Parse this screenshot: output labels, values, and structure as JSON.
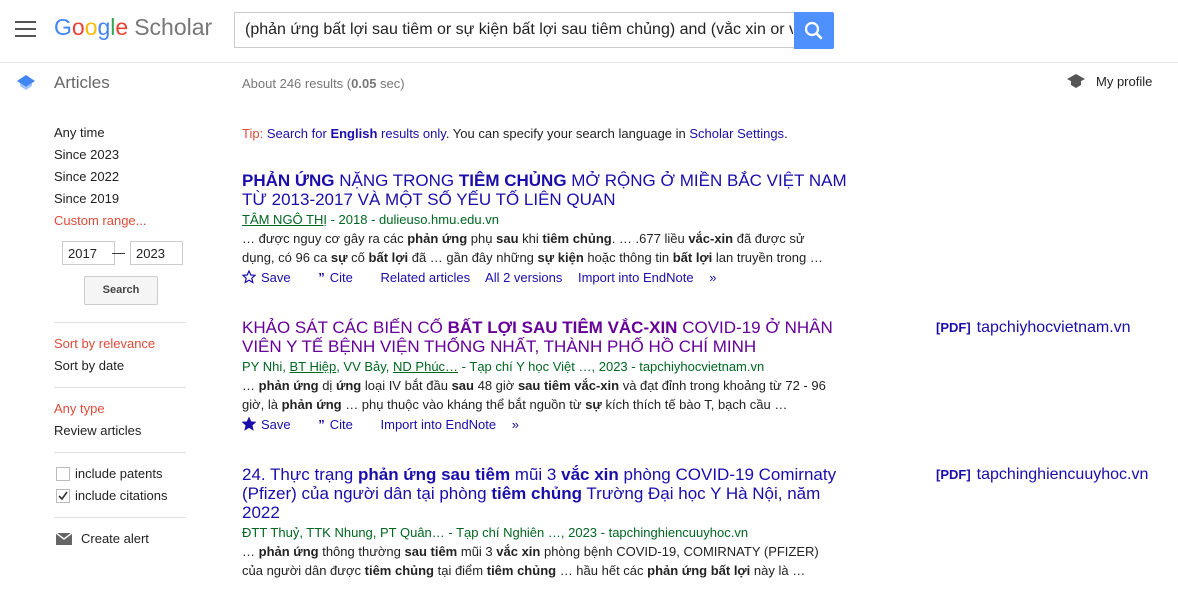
{
  "header": {
    "logo_google": [
      "G",
      "o",
      "o",
      "g",
      "l",
      "e"
    ],
    "logo_scholar": "Scholar",
    "search_query": "(phản ứng bất lợi sau tiêm or sự kiện bất lợi sau tiêm chủng) and (vắc xin or vaccine)"
  },
  "subheader": {
    "section_label": "Articles",
    "result_prefix": "About 246 results (",
    "result_time": "0.05",
    "result_suffix": " sec)",
    "my_profile": "My profile"
  },
  "sidebar": {
    "time_filters": [
      "Any time",
      "Since 2023",
      "Since 2022",
      "Since 2019",
      "Custom range..."
    ],
    "year_from": "2017",
    "year_to": "2023",
    "year_dash": "—",
    "search_label": "Search",
    "sort_filters": [
      "Sort by relevance",
      "Sort by date"
    ],
    "type_filters": [
      "Any type",
      "Review articles"
    ],
    "include_patents": "include patents",
    "include_citations": "include citations",
    "create_alert": "Create alert"
  },
  "tip": {
    "tip_label": "Tip:",
    "search_for": "Search for",
    "english": "English",
    "results_only": "results only",
    "middle": ". You can specify your search language in",
    "settings": "Scholar Settings",
    "end": "."
  },
  "results": [
    {
      "title_segments": [
        {
          "t": "PHẢN ỨNG",
          "b": true
        },
        {
          "t": " NẶNG TRONG ",
          "b": false
        },
        {
          "t": "TIÊM CHỦNG",
          "b": true
        },
        {
          "t": " MỞ RỘNG Ở MIỀN BẮC VIỆT NAM TỪ 2013-2017 VÀ MỘT SỐ YẾU TỐ LIÊN QUAN",
          "b": false
        }
      ],
      "author_link": "TÂM NGÔ THỊ",
      "author_rest": " - 2018 - dulieuso.hmu.edu.vn",
      "snippet_segments": [
        {
          "t": "… được nguy cơ gây ra các ",
          "b": false
        },
        {
          "t": "phản ứng",
          "b": true
        },
        {
          "t": " phụ ",
          "b": false
        },
        {
          "t": "sau",
          "b": true
        },
        {
          "t": " khi ",
          "b": false
        },
        {
          "t": "tiêm chủng",
          "b": true
        },
        {
          "t": ". … .677 liều ",
          "b": false
        },
        {
          "t": "vắc-xin",
          "b": true
        },
        {
          "t": " đã được sử dụng, có 96 ca ",
          "b": false
        },
        {
          "t": "sự",
          "b": true
        },
        {
          "t": " cố ",
          "b": false
        },
        {
          "t": "bất lợi",
          "b": true
        },
        {
          "t": " đã … gần đây những ",
          "b": false
        },
        {
          "t": "sự kiện",
          "b": true
        },
        {
          "t": " hoặc thông tin ",
          "b": false
        },
        {
          "t": "bất lợi",
          "b": true
        },
        {
          "t": " lan truyền trong …",
          "b": false
        }
      ],
      "actions": [
        "Save",
        "Cite",
        "Related articles",
        "All 2 versions",
        "Import into EndNote"
      ]
    },
    {
      "title_segments": [
        {
          "t": "KHẢO SÁT CÁC BIẾN CỐ ",
          "b": false
        },
        {
          "t": "BẤT LỢI SAU TIÊM VẮC-XIN",
          "b": true
        },
        {
          "t": " COVID-19 Ở NHÂN VIÊN Y TẾ BỆNH VIỆN THỐNG NHẤT, THÀNH PHỐ HỒ CHÍ MINH",
          "b": false
        }
      ],
      "authors_a": "PY Nhi, ",
      "authors_b": "BT Hiệp",
      "authors_c": ", VV Bảy, ",
      "authors_d": "ND Phúc…",
      "authors_e": " - Tạp chí Y học Việt …, 2023 - tapchiyhocvietnam.vn",
      "snippet_segments": [
        {
          "t": "… ",
          "b": false
        },
        {
          "t": "phản ứng",
          "b": true
        },
        {
          "t": " dị ",
          "b": false
        },
        {
          "t": "ứng",
          "b": true
        },
        {
          "t": " loại IV bắt đầu ",
          "b": false
        },
        {
          "t": "sau",
          "b": true
        },
        {
          "t": " 48 giờ ",
          "b": false
        },
        {
          "t": "sau tiêm vắc-xin",
          "b": true
        },
        {
          "t": " và đạt đỉnh trong khoảng từ 72 - 96 giờ, là ",
          "b": false
        },
        {
          "t": "phản ứng",
          "b": true
        },
        {
          "t": " … phụ thuộc vào kháng thể bắt nguồn từ ",
          "b": false
        },
        {
          "t": "sự",
          "b": true
        },
        {
          "t": " kích thích tế bào T, bạch cầu …",
          "b": false
        }
      ],
      "actions": [
        "Save",
        "Cite",
        "Import into EndNote"
      ],
      "pdf_tag": "[PDF]",
      "pdf_source": "tapchiyhocvietnam.vn"
    },
    {
      "title_segments": [
        {
          "t": "24. Thực trạng ",
          "b": false
        },
        {
          "t": "phản ứng sau tiêm",
          "b": true
        },
        {
          "t": " mũi 3 ",
          "b": false
        },
        {
          "t": "vắc xin",
          "b": true
        },
        {
          "t": " phòng COVID-19 Comirnaty (Pfizer) của người dân tại phòng ",
          "b": false
        },
        {
          "t": "tiêm chủng",
          "b": true
        },
        {
          "t": " Trường Đại học Y Hà Nội, năm 2022",
          "b": false
        }
      ],
      "authors_text": "ĐTT Thuỷ, TTK Nhung, PT Quân… - Tạp chí Nghiên …, 2023 - tapchinghiencuuyhoc.vn",
      "snippet_segments": [
        {
          "t": "… ",
          "b": false
        },
        {
          "t": "phản ứng",
          "b": true
        },
        {
          "t": " thông thường ",
          "b": false
        },
        {
          "t": "sau tiêm",
          "b": true
        },
        {
          "t": " mũi 3 ",
          "b": false
        },
        {
          "t": "vắc xin",
          "b": true
        },
        {
          "t": " phòng bệnh COVID-19, COMIRNATY (PFIZER) của người dân được ",
          "b": false
        },
        {
          "t": "tiêm chủng",
          "b": true
        },
        {
          "t": " tại điểm ",
          "b": false
        },
        {
          "t": "tiêm chủng",
          "b": true
        },
        {
          "t": " … hầu hết các ",
          "b": false
        },
        {
          "t": "phản ứng bất lợi",
          "b": true
        },
        {
          "t": " này là …",
          "b": false
        }
      ],
      "pdf_tag": "[PDF]",
      "pdf_source": "tapchinghiencuuyhoc.vn"
    }
  ]
}
